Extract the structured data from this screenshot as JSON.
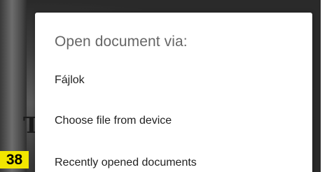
{
  "dialog": {
    "title": "Open document via:",
    "options": [
      {
        "label": "Fájlok"
      },
      {
        "label": "Choose file from device"
      },
      {
        "label": "Recently opened documents"
      }
    ]
  },
  "page_badge": "38",
  "background": {
    "letter": "T"
  },
  "colors": {
    "title_text": "#666666",
    "option_text": "#222222",
    "badge": "#f2e600"
  }
}
